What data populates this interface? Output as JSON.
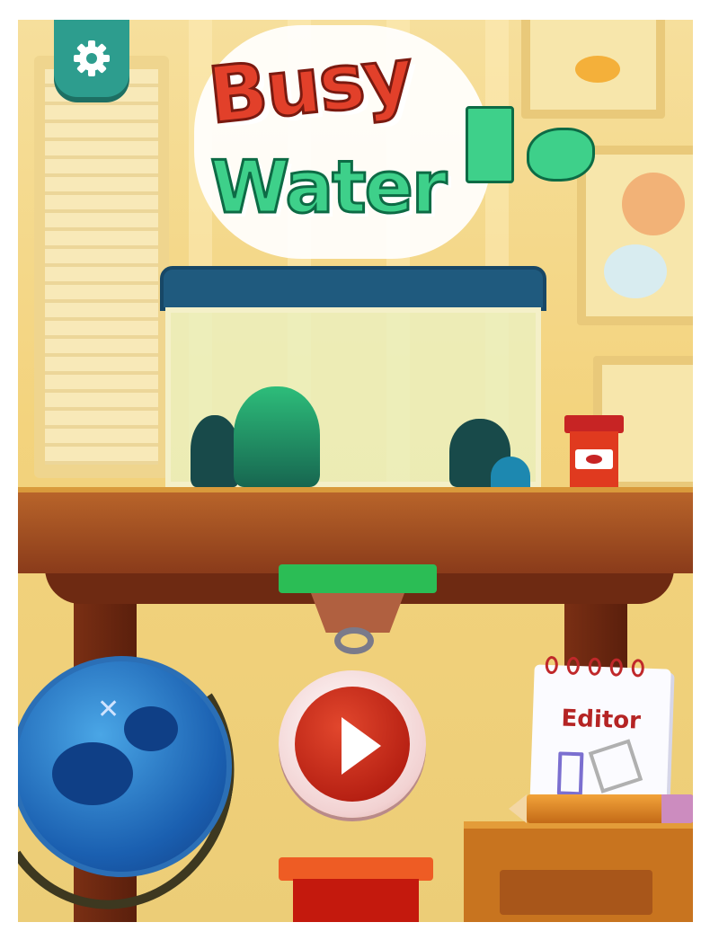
{
  "game": {
    "title_line1": "Busy",
    "title_line2": "Water"
  },
  "buttons": {
    "settings_icon": "gear-icon",
    "play_icon": "play-icon",
    "editor_label": "Editor"
  },
  "colors": {
    "play_red": "#c42a17",
    "settings_teal": "#2d9d8e",
    "tank_lid": "#1f5a7e",
    "logo_red": "#e2402a",
    "logo_green": "#3ed08a"
  }
}
